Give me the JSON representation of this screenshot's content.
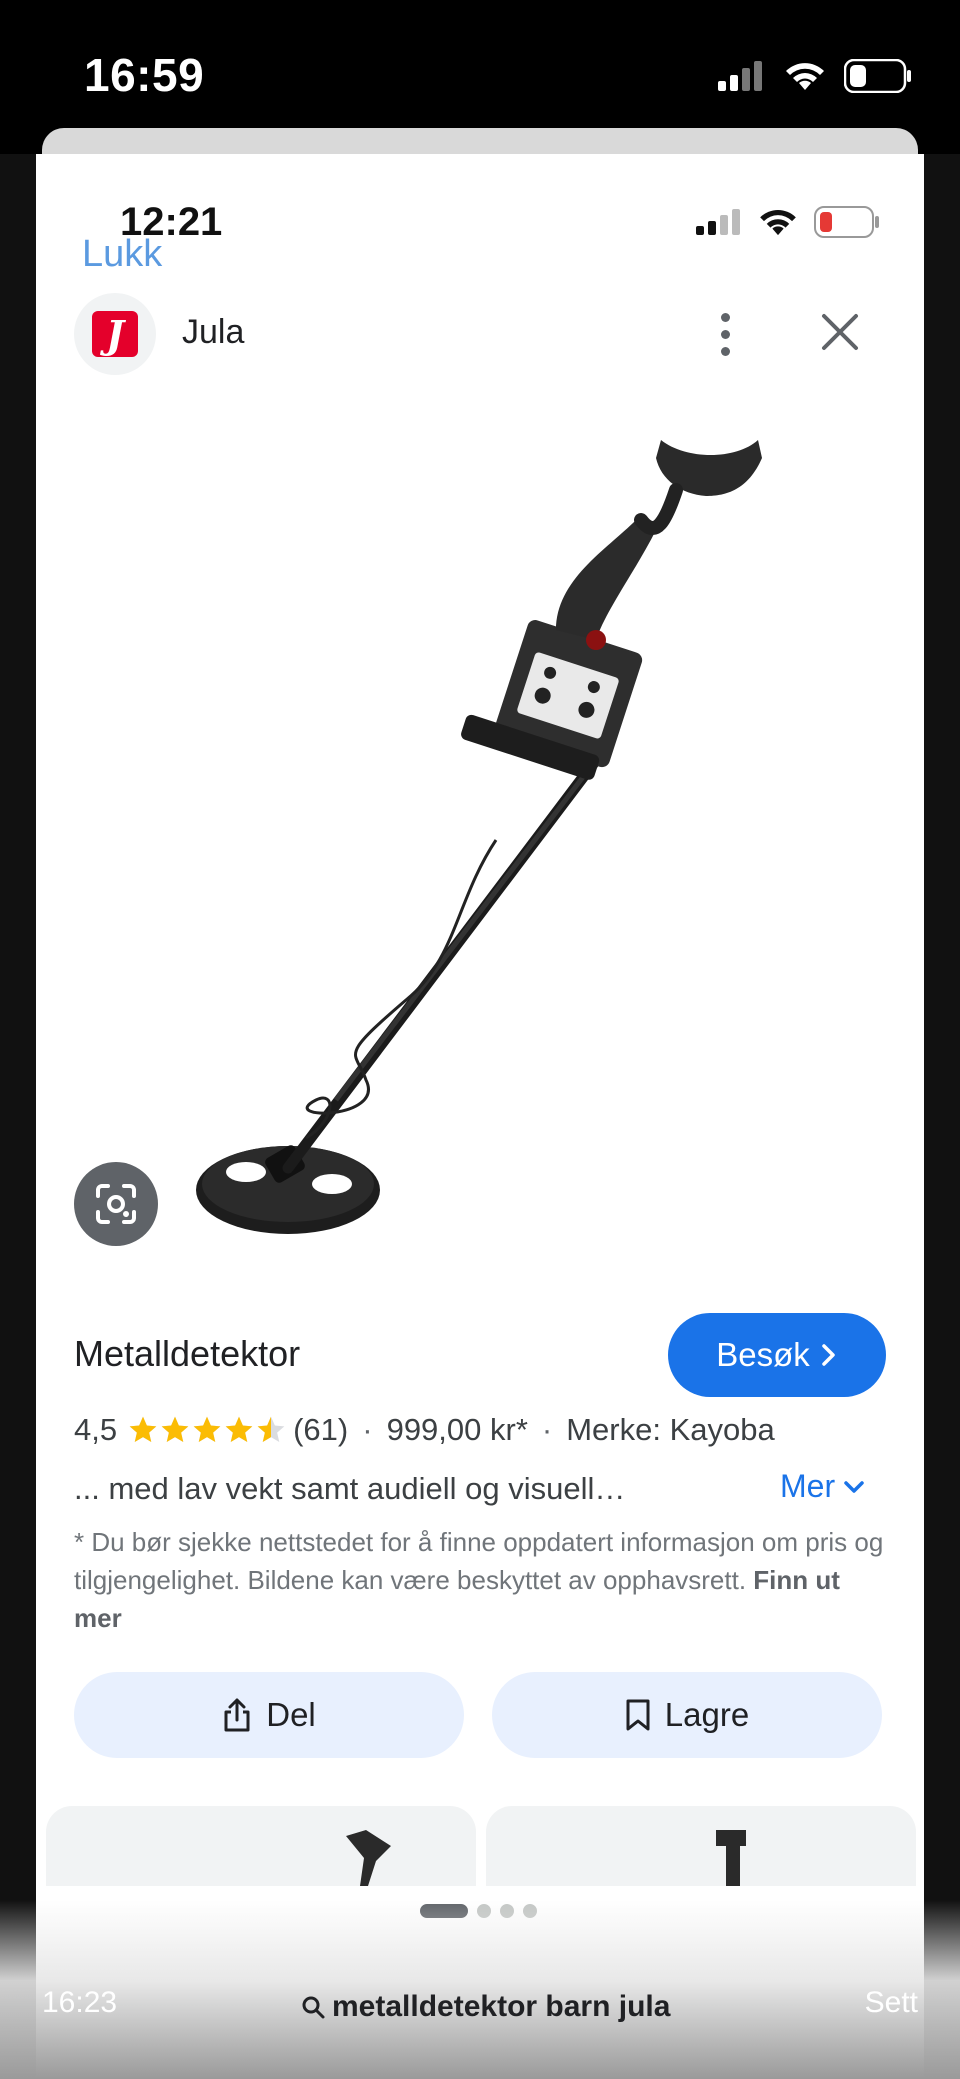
{
  "outer_status": {
    "time": "16:59"
  },
  "inner_status": {
    "time": "12:21",
    "back_label": "Lukk"
  },
  "source": {
    "name": "Jula",
    "logo_letter": "J",
    "logo_color": "#e4002b"
  },
  "product": {
    "title": "Metalldetektor",
    "visit_label": "Besøk",
    "rating": "4,5",
    "rating_value": 4.5,
    "rating_max": 5,
    "review_count": "(61)",
    "price": "999,00 kr*",
    "brand": "Merke: Kayoba",
    "description": "... med lav vekt samt audiell og visuell…",
    "more_label": "Mer"
  },
  "disclaimer": {
    "text": "* Du bør sjekke nettstedet for å finne oppdatert informasjon om pris og tilgjengelighet. Bildene kan være beskyttet av opphavsrett. ",
    "link": "Finn ut mer"
  },
  "actions": {
    "share_label": "Del",
    "save_label": "Lagre"
  },
  "pager": {
    "pages": 4,
    "active": 1
  },
  "bottom_bar": {
    "time": "16:23",
    "search_text": "metalldetektor barn jula",
    "right_text": "Sett"
  },
  "colors": {
    "accent": "#1a73e8",
    "star": "#fbbc04",
    "chip_bg": "#e8f0fe"
  }
}
